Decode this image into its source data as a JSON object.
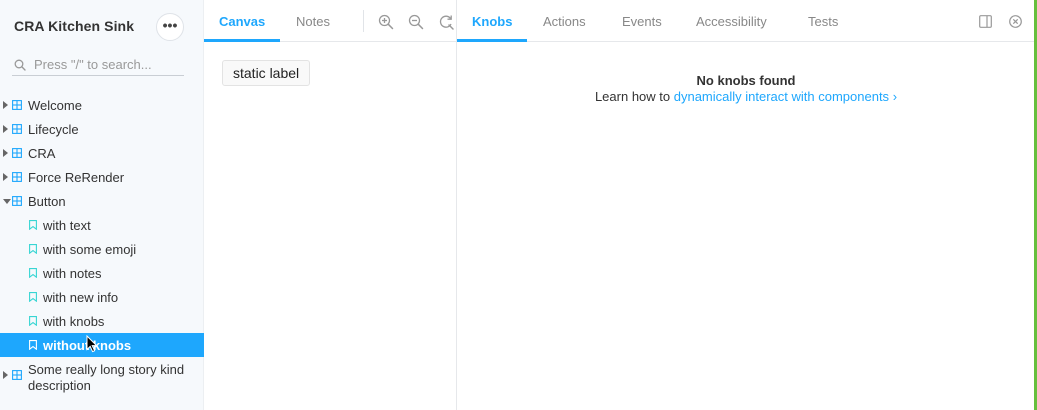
{
  "sidebar": {
    "title": "CRA Kitchen Sink",
    "menu_icon": "ellipsis-icon",
    "search": {
      "placeholder": "Press \"/\" to search...",
      "value": ""
    },
    "groups": [
      {
        "label": "Welcome",
        "expanded": false
      },
      {
        "label": "Lifecycle",
        "expanded": false
      },
      {
        "label": "CRA",
        "expanded": false
      },
      {
        "label": "Force ReRender",
        "expanded": false
      },
      {
        "label": "Button",
        "expanded": true
      }
    ],
    "stories": [
      {
        "label": "with text"
      },
      {
        "label": "with some emoji"
      },
      {
        "label": "with notes"
      },
      {
        "label": "with new info"
      },
      {
        "label": "with knobs"
      },
      {
        "label": "without knobs",
        "selected": true
      }
    ],
    "last_group": {
      "label": "Some really long story kind description",
      "expanded": false
    }
  },
  "preview": {
    "tabs": [
      {
        "label": "Canvas",
        "active": true
      },
      {
        "label": "Notes",
        "active": false
      }
    ],
    "tools": [
      "zoom-in-icon",
      "zoom-out-icon",
      "zoom-reset-icon"
    ],
    "canvas_button_label": "static label"
  },
  "panel": {
    "tabs": [
      {
        "label": "Knobs",
        "active": true
      },
      {
        "label": "Actions",
        "active": false
      },
      {
        "label": "Events",
        "active": false
      },
      {
        "label": "Accessibility",
        "active": false
      },
      {
        "label": "Tests",
        "active": false
      }
    ],
    "empty_title": "No knobs found",
    "empty_prefix": "Learn how to ",
    "empty_link": "dynamically interact with components",
    "empty_link_chevron": "›",
    "controls": [
      "panel-orientation-icon",
      "close-panel-icon"
    ]
  },
  "colors": {
    "accent": "#1ea7fd",
    "sidebar_bg": "#f6f9fc",
    "edge": "#66bf3c"
  }
}
